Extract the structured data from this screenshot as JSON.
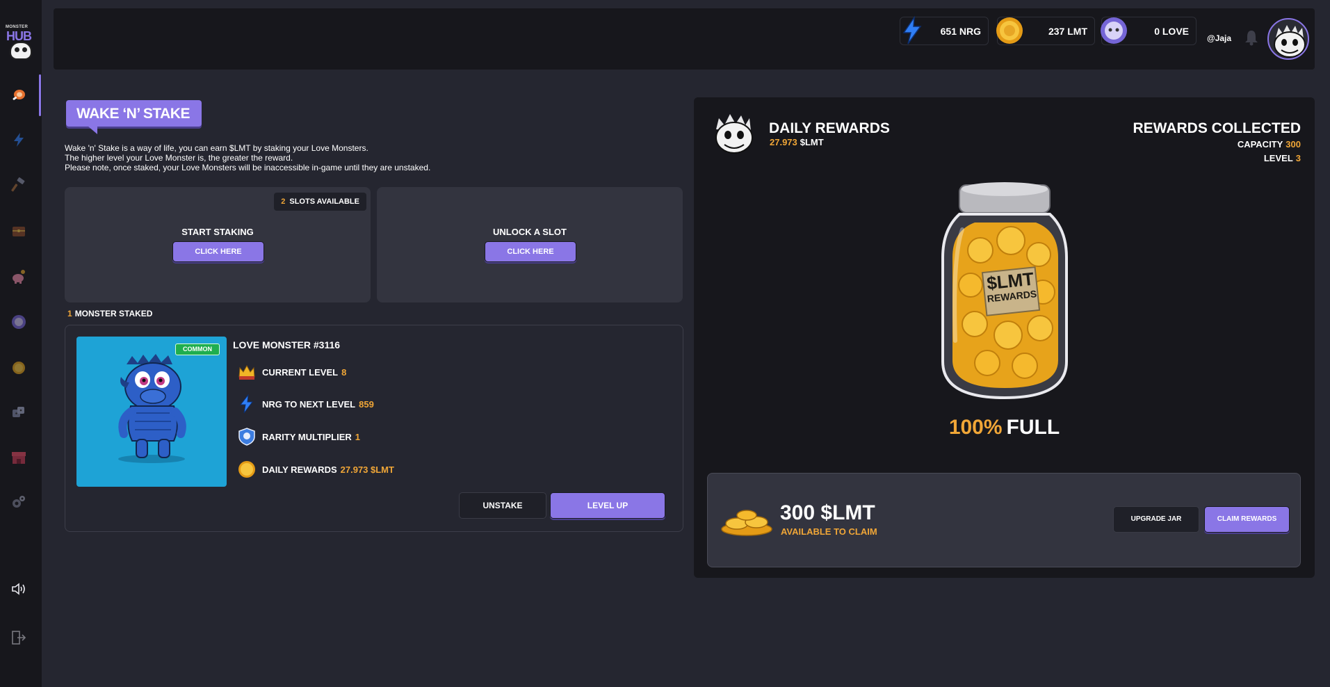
{
  "app": {
    "logo_small": "MONSTER",
    "logo_big": "HUB"
  },
  "sidebar": {
    "items": [
      "stake",
      "energy",
      "craft",
      "chest",
      "piggy-bank",
      "love",
      "coin",
      "dice",
      "shop",
      "settings"
    ],
    "bottom": [
      "sound",
      "logout"
    ]
  },
  "topbar": {
    "nrg": "651 NRG",
    "lmt": "237 LMT",
    "love": "0 LOVE",
    "username": "@Jaja"
  },
  "stake": {
    "title": "WAKE ‘N’ STAKE",
    "intro": [
      "Wake 'n' Stake is a way of life, you can earn $LMT by staking your Love Monsters.",
      "The higher level your Love Monster is, the greater the reward.",
      "Please note, once staked, your Love Monsters will be inaccessible in-game until they are unstaked."
    ],
    "slots_count": "2",
    "slots_label": "SLOTS AVAILABLE",
    "start_title": "START STAKING",
    "start_button": "CLICK HERE",
    "unlock_title": "UNLOCK A SLOT",
    "unlock_button": "CLICK HERE",
    "staked_count": "1",
    "staked_label": "MONSTER STAKED"
  },
  "monster": {
    "name": "LOVE MONSTER #3116",
    "rarity": "COMMON",
    "current_level_label": "CURRENT LEVEL",
    "current_level": "8",
    "nrg_label": "NRG TO NEXT LEVEL",
    "nrg_value": "859",
    "rarity_label": "RARITY MULTIPLIER",
    "rarity_value": "1",
    "daily_label": "DAILY REWARDS",
    "daily_value": "27.973 $LMT",
    "unstake_button": "UNSTAKE",
    "levelup_button": "LEVEL UP"
  },
  "rewards": {
    "daily_title": "DAILY REWARDS",
    "daily_amount": "27.973",
    "daily_unit": "$LMT",
    "collected_title": "REWARDS COLLECTED",
    "capacity_label": "CAPACITY",
    "capacity_value": "300",
    "level_label": "LEVEL",
    "level_value": "3",
    "jar_label_top": "$LMT",
    "jar_label_bottom": "REWARDS",
    "fill_pct": "100%",
    "fill_word": "FULL",
    "claim_amount": "300 $LMT",
    "claim_sub": "AVAILABLE TO CLAIM",
    "upgrade_button": "UPGRADE JAR",
    "claim_button": "CLAIM REWARDS"
  },
  "colors": {
    "accent": "#8a76e6",
    "highlight": "#f0a637",
    "panel": "#33343f",
    "background": "#252630",
    "dark": "#17171c"
  }
}
